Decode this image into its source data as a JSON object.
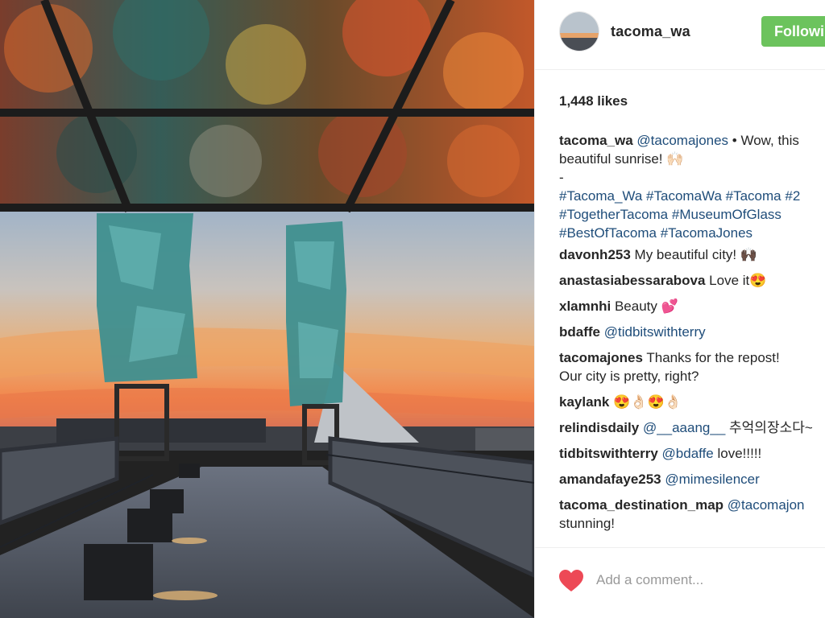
{
  "post": {
    "image_alt": "Sunrise view from the Bridge of Glass with glass sculptures and the Museum of Glass cone",
    "colors": {
      "follow_button": "#6cc35d",
      "link": "#1f4d7a",
      "heart": "#ed4956"
    }
  },
  "header": {
    "username": "tacoma_wa",
    "follow_label": "Followi"
  },
  "likes": "1,448 likes",
  "caption": {
    "user": "tacoma_wa",
    "mention": "@tacomajones",
    "text_line1": " • Wow, this",
    "text_line2": "beautiful sunrise! 🙌🏻",
    "dash": "-",
    "tags_line1": [
      "#Tacoma_Wa",
      "#TacomaWa",
      "#Tacoma",
      "#2"
    ],
    "tags_line2": [
      "#TogetherTacoma",
      "#MuseumOfGlass"
    ],
    "tags_line3": [
      "#BestOfTacoma",
      "#TacomaJones"
    ]
  },
  "comments": [
    {
      "user": "davonh253",
      "text": " My beautiful city! 🙌🏿"
    },
    {
      "user": "anastasiabessarabova",
      "text": " Love it😍"
    },
    {
      "user": "xlamnhi",
      "text": " Beauty 💕"
    },
    {
      "user": "bdaffe",
      "mention": "@tidbitswithterry"
    },
    {
      "user": "tacomajones",
      "text": " Thanks for the repost!",
      "text2": "Our city is pretty, right?"
    },
    {
      "user": "kaylank",
      "text": " 😍👌🏻😍👌🏻"
    },
    {
      "user": "relindisdaily",
      "mention": "@__aaang__",
      "text": " 추억의장소다~"
    },
    {
      "user": "tidbitswithterry",
      "mention": "@bdaffe",
      "text": " love!!!!!"
    },
    {
      "user": "amandafaye253",
      "mention": "@mimesilencer"
    },
    {
      "user": "tacoma_destination_map",
      "mention": "@tacomajon",
      "text2": "stunning!"
    }
  ],
  "footer": {
    "like_icon": "heart-icon",
    "comment_placeholder": "Add a comment..."
  }
}
